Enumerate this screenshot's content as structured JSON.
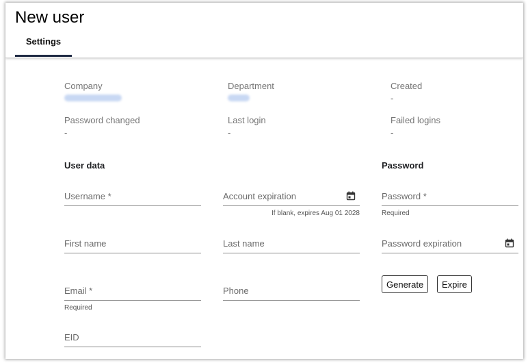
{
  "page": {
    "title": "New user"
  },
  "tabs": [
    {
      "label": "Settings",
      "active": true
    }
  ],
  "meta": {
    "company": {
      "label": "Company",
      "value": ""
    },
    "department": {
      "label": "Department",
      "value": ""
    },
    "created": {
      "label": "Created",
      "value": "-"
    },
    "password_changed": {
      "label": "Password changed",
      "value": "-"
    },
    "last_login": {
      "label": "Last login",
      "value": "-"
    },
    "failed_logins": {
      "label": "Failed logins",
      "value": "-"
    }
  },
  "user_data": {
    "title": "User data",
    "username": {
      "label": "Username *",
      "value": "",
      "hint": ""
    },
    "account_expiration": {
      "label": "Account expiration",
      "hint": "If blank, expires Aug 01 2028",
      "icon": "calendar-icon"
    },
    "first_name": {
      "label": "First name",
      "value": ""
    },
    "last_name": {
      "label": "Last name",
      "value": ""
    },
    "email": {
      "label": "Email *",
      "value": "",
      "hint": "Required"
    },
    "phone": {
      "label": "Phone",
      "value": ""
    },
    "eid": {
      "label": "EID",
      "value": ""
    }
  },
  "password": {
    "title": "Password",
    "password": {
      "label": "Password *",
      "hint": "Required"
    },
    "password_expiration": {
      "label": "Password expiration",
      "icon": "calendar-icon"
    },
    "generate_label": "Generate",
    "expire_label": "Expire"
  },
  "colors": {
    "tab_underline": "#1f2a44",
    "redacted": "#c8d8f3",
    "field_border": "#8a8a8a"
  }
}
